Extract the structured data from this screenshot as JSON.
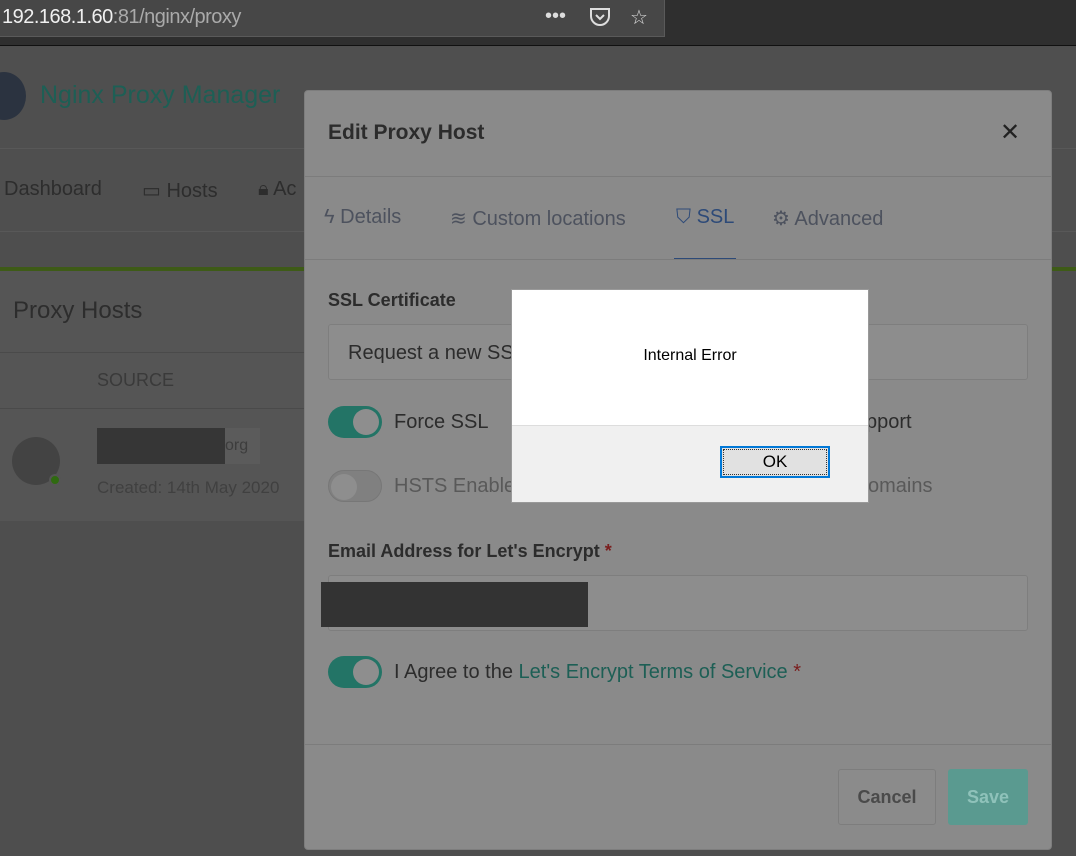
{
  "browser": {
    "url_host": "192.168.1.60",
    "url_rest": ":81/nginx/proxy",
    "icons": [
      "more-icon",
      "pocket-icon",
      "bookmark-star-icon"
    ]
  },
  "app": {
    "brand": "Nginx Proxy Manager",
    "nav": [
      "Dashboard",
      "Hosts",
      "Ac"
    ]
  },
  "page": {
    "title": "Proxy Hosts",
    "column_source": "SOURCE",
    "row": {
      "domain_suffix": "org",
      "created": "Created: 14th May 2020"
    }
  },
  "modal": {
    "title": "Edit Proxy Host",
    "close": "X",
    "tabs": [
      "Details",
      "Custom locations",
      "SSL",
      "Advanced"
    ],
    "active_tab": "SSL",
    "ssl_certificate_label": "SSL Certificate",
    "ssl_certificate_value": "Request a new SS",
    "force_ssl": {
      "label": "Force SSL",
      "on": true
    },
    "http2_partial": "pport",
    "hsts": {
      "label": "HSTS Enable",
      "on": false
    },
    "hsts_sub_partial": "omains",
    "email_label": "Email Address for Let's Encrypt",
    "required_mark": "*",
    "agree": {
      "prefix": "I Agree to the ",
      "link": "Let's Encrypt Terms of Service",
      "on": true
    },
    "cancel": "Cancel",
    "save": "Save"
  },
  "dialog": {
    "message": "Internal Error",
    "ok": "OK"
  },
  "colors": {
    "accent": "#237466",
    "tab_active": "#2d4a78",
    "dialog_focus": "#0078d7"
  }
}
